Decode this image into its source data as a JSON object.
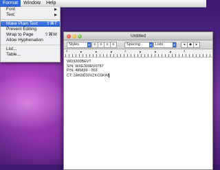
{
  "menubar": {
    "format": "Format",
    "window": "Window",
    "help": "Help"
  },
  "format_menu": {
    "items": [
      {
        "label": "Font",
        "arrow": "▶"
      },
      {
        "label": "Text",
        "arrow": "▶"
      },
      {
        "label": "Make Plain Text",
        "shortcut": "⇧⌘T"
      },
      {
        "label": "Prevent Editing"
      },
      {
        "label": "Wrap to Page",
        "shortcut": "⇧⌘W"
      },
      {
        "label": "Allow Hyphenation"
      },
      {
        "label": "List..."
      },
      {
        "label": "Table..."
      }
    ]
  },
  "window": {
    "title": "Untitled",
    "toolbar": {
      "styles": "Styles",
      "spacing": "Spacing",
      "lists": "Lists"
    },
    "ruler": {
      "numbers": [
        "0",
        "2",
        "4"
      ]
    },
    "content": [
      "WD3200BEVT",
      "S/N: WXE309RV0787",
      "P/N: 485899 - 003",
      "CT: 2AKBE00VZKCSKW"
    ]
  }
}
